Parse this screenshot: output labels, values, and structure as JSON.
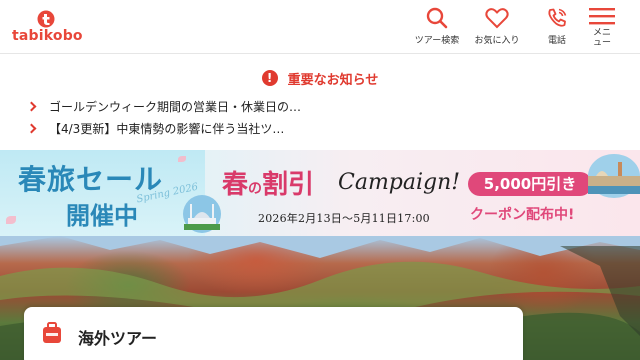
{
  "header": {
    "logo_text": "tabikobo",
    "nav": [
      {
        "label": "ツアー検索",
        "icon": "search-icon"
      },
      {
        "label": "お気に入り",
        "icon": "heart-icon"
      },
      {
        "label": "電話",
        "icon": "phone-icon"
      },
      {
        "label": "メニュー",
        "icon": "hamburger-icon"
      }
    ]
  },
  "notice": {
    "title": "重要なお知らせ",
    "items": [
      "ゴールデンウィーク期間の営業日・休業日の…",
      "【4/3更新】中東情勢の影響に伴う当社ツ…"
    ]
  },
  "banner": {
    "left_title": "春旅セール",
    "left_sub": "開催中",
    "left_script": "Spring 2026",
    "campaign_jp_1": "春",
    "campaign_jp_no": "の",
    "campaign_jp_2": "割引",
    "campaign_en": "Campaign!",
    "dates": "2026年2月13日～5月11日17:00",
    "coupon_amount": "5,000円引き",
    "coupon_text": "クーポン配布中!"
  },
  "tour": {
    "label": "海外ツアー"
  },
  "colors": {
    "brand": "#e8473a",
    "alert": "#e03a2f",
    "campaign_pink": "#e0487a",
    "spring_blue": "#2a88b8"
  }
}
